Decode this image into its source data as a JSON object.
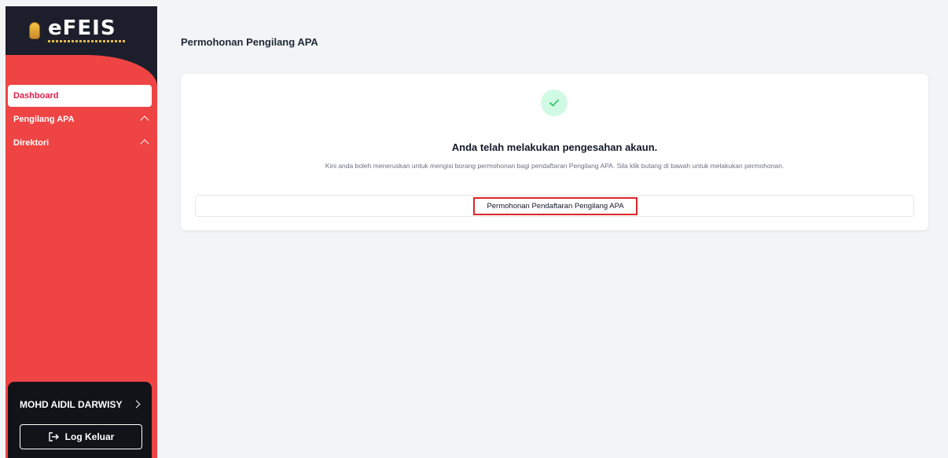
{
  "sidebar": {
    "logo_text": "eFEIS",
    "items": [
      {
        "label": "Dashboard",
        "active": true
      },
      {
        "label": "Pengilang APA",
        "expanded": true
      },
      {
        "label": "Direktori",
        "expanded": true
      }
    ],
    "user": {
      "name": "MOHD AIDIL DARWISY",
      "logout_label": "Log Keluar"
    }
  },
  "main": {
    "title": "Permohonan Pengilang APA",
    "card": {
      "icon": "check-icon",
      "heading": "Anda telah melakukan pengesahan akaun.",
      "description": "Kini anda boleh meneruskan untuk mengisi borang permohonan bagi pendaftaran Pengilang APA. Sila klik butang di bawah untuk melakukan permohonan.",
      "button_label": "Permohonan Pendaftaran Pengilang APA"
    }
  },
  "colors": {
    "sidebar_bg": "#ef4444",
    "sidebar_dark": "#1c1f2b",
    "highlight_border": "#dc2626",
    "success_bg": "#d1fae5",
    "success_icon": "#22c55e"
  }
}
